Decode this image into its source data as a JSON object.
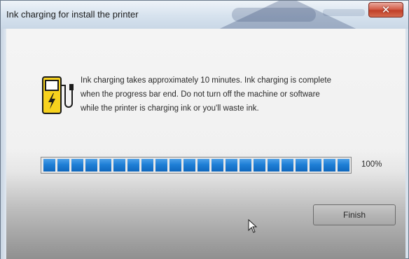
{
  "window": {
    "title": "Ink charging for install the printer",
    "close_glyph": "✕"
  },
  "message": {
    "icon": "ink-pump-icon",
    "lines": [
      "Ink charging takes approximately 10 minutes. Ink charging is complete",
      "when the  progress bar end. Do not turn off the machine or software",
      "while the printer is charging ink or you'll waste ink."
    ]
  },
  "progress": {
    "value": 1.0,
    "label": "100%",
    "color": "#1f7fd6"
  },
  "buttons": {
    "finish": "Finish"
  },
  "colors": {
    "icon_yellow": "#f7d21e",
    "close_red": "#c13f28"
  }
}
